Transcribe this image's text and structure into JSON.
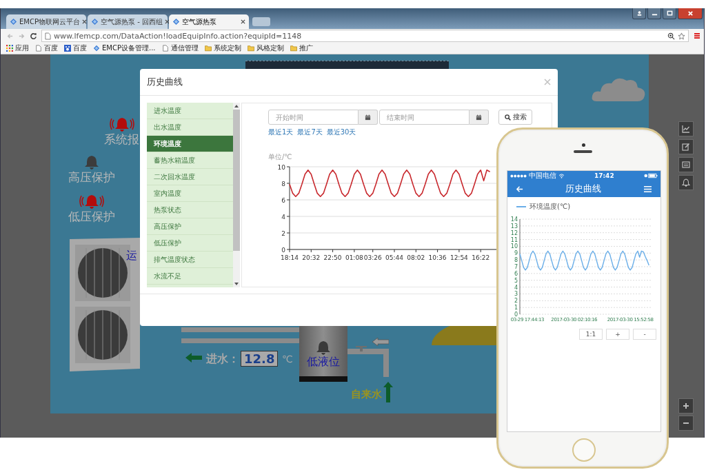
{
  "browser": {
    "tabs": [
      {
        "title": "EMCP物联网云平台",
        "selected": false
      },
      {
        "title": "空气源热泵 - 回西组",
        "selected": false
      },
      {
        "title": "空气源热泵",
        "selected": true
      }
    ],
    "url": "www.lfemcp.com/DataAction!loadEquipInfo.action?equipId=1148",
    "bookmarks": [
      {
        "label": "应用",
        "kind": "apps"
      },
      {
        "label": "百度",
        "kind": "page"
      },
      {
        "label": "百度",
        "kind": "baidu"
      },
      {
        "label": "EMCP设备管理...",
        "kind": "emcp"
      },
      {
        "label": "通信管理",
        "kind": "page"
      },
      {
        "label": "系统定制",
        "kind": "folder"
      },
      {
        "label": "风格定制",
        "kind": "folder"
      },
      {
        "label": "推广",
        "kind": "folder"
      }
    ]
  },
  "scada": {
    "alarms": [
      {
        "label": "系统报",
        "alarm": true
      },
      {
        "label": "高压保护",
        "alarm": false
      },
      {
        "label": "低压保护",
        "alarm": true
      }
    ],
    "unit_label": "运",
    "inlet": {
      "label": "进水：",
      "value": "12.8",
      "unit": "℃"
    },
    "tank": {
      "label": "低液位",
      "alarm": false
    },
    "tap_water": "自来水"
  },
  "modal": {
    "title": "历史曲线",
    "items": [
      {
        "label": "进水温度",
        "selected": false
      },
      {
        "label": "出水温度",
        "selected": false
      },
      {
        "label": "环境温度",
        "selected": true
      },
      {
        "label": "蓄热水箱温度",
        "selected": false
      },
      {
        "label": "二次回水温度",
        "selected": false
      },
      {
        "label": "室内温度",
        "selected": false
      },
      {
        "label": "热泵状态",
        "selected": false
      },
      {
        "label": "高压保护",
        "selected": false
      },
      {
        "label": "低压保护",
        "selected": false
      },
      {
        "label": "排气温度状态",
        "selected": false
      },
      {
        "label": "水流不足",
        "selected": false
      }
    ],
    "start_placeholder": "开始时间",
    "end_placeholder": "结束时间",
    "search_button": "搜索",
    "quick_ranges": [
      "最近1天",
      "最近7天",
      "最近30天"
    ],
    "chart_data": {
      "type": "line",
      "ylabel": "单位/℃",
      "categories": [
        "18:14",
        null,
        null,
        null,
        null,
        null,
        null,
        "20:32",
        null,
        null,
        null,
        null,
        null,
        null,
        "22:50",
        null,
        null,
        null,
        null,
        null,
        null,
        "01:08",
        null,
        null,
        null,
        null,
        null,
        "03:26",
        null,
        null,
        null,
        null,
        null,
        null,
        "05:44",
        null,
        null,
        null,
        null,
        null,
        null,
        "08:02",
        null,
        null,
        null,
        null,
        null,
        null,
        "10:36",
        null,
        null,
        null,
        null,
        null,
        null,
        "12:54",
        null,
        null,
        null,
        null,
        null,
        null,
        "16:22",
        null,
        null,
        null
      ],
      "series": [
        {
          "color": "#c8282d",
          "values": [
            7.9,
            6.8,
            6.4,
            6.8,
            7.9,
            9.1,
            9.6,
            9.1,
            7.9,
            6.8,
            6.4,
            6.8,
            7.9,
            9.1,
            9.6,
            9.1,
            7.9,
            6.8,
            6.4,
            6.8,
            7.9,
            9.1,
            9.6,
            9.1,
            7.9,
            6.8,
            6.4,
            6.8,
            7.9,
            9.1,
            9.6,
            9.1,
            7.9,
            6.8,
            6.4,
            6.8,
            7.9,
            9.1,
            9.6,
            9.1,
            7.9,
            6.8,
            6.4,
            6.8,
            7.9,
            9.1,
            9.6,
            9.1,
            7.9,
            6.8,
            6.4,
            6.8,
            7.9,
            9.1,
            9.6,
            9.1,
            7.9,
            6.8,
            6.4,
            6.8,
            7.9,
            9.1,
            9.6,
            8.3,
            9.6,
            9.4
          ]
        }
      ],
      "ylim": [
        0,
        10
      ],
      "yticks": [
        0,
        2,
        4,
        6,
        8,
        10
      ],
      "grid": true
    }
  },
  "phone": {
    "carrier": "中国电信",
    "time": "17:42",
    "title": "历史曲线",
    "chart_data": {
      "type": "line",
      "categories": [
        null,
        null,
        null,
        null,
        "03-29 17:44:13",
        null,
        null,
        null,
        null,
        null,
        null,
        null,
        null,
        null,
        null,
        null,
        null,
        null,
        null,
        null,
        null,
        null,
        null,
        null,
        null,
        null,
        null,
        null,
        null,
        "2017-03-30 02:10:16",
        null,
        null,
        null,
        null,
        null,
        null,
        null,
        null,
        null,
        null,
        null,
        null,
        null,
        null,
        null,
        null,
        null,
        null,
        null,
        null,
        null,
        null,
        null,
        null,
        null,
        null,
        null,
        null,
        null,
        "2017-03-30 15:52:58",
        null,
        null,
        null,
        null,
        null,
        null,
        null,
        null,
        null,
        null
      ],
      "series": [
        {
          "name": "环境温度(℃)",
          "color": "#6aaee8",
          "values": [
            8.9,
            7.9,
            6.9,
            6.5,
            6.9,
            7.9,
            8.9,
            9.3,
            8.9,
            7.9,
            6.9,
            6.5,
            6.9,
            7.9,
            8.9,
            9.3,
            8.9,
            7.9,
            6.9,
            6.5,
            6.9,
            7.9,
            8.9,
            9.3,
            8.9,
            7.9,
            6.9,
            6.5,
            6.9,
            7.9,
            8.9,
            9.3,
            8.9,
            7.9,
            6.9,
            6.5,
            6.9,
            7.9,
            8.9,
            9.3,
            8.9,
            7.9,
            6.9,
            6.5,
            6.9,
            7.9,
            8.9,
            9.3,
            8.9,
            7.9,
            6.9,
            6.5,
            6.9,
            7.9,
            8.9,
            9.3,
            8.9,
            7.9,
            6.9,
            6.5,
            6.9,
            7.9,
            8.9,
            9.3,
            8.4,
            9.3,
            9.2,
            8.5,
            7.9,
            7.2
          ]
        }
      ],
      "ylim": [
        0,
        14
      ],
      "yticks": [
        0,
        1,
        2,
        3,
        4,
        5,
        6,
        7,
        8,
        9,
        10,
        11,
        12,
        13,
        14
      ],
      "grid": true
    },
    "buttons": [
      "1:1",
      "+",
      "-"
    ]
  }
}
